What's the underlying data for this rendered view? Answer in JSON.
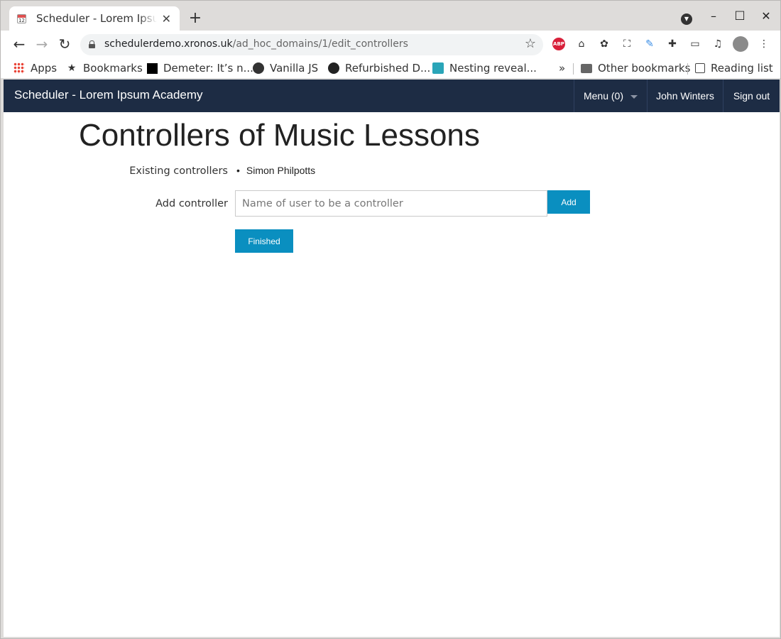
{
  "browser": {
    "tab_title": "Scheduler - Lorem Ipsum Academy",
    "favicon_text": "12",
    "url_host": "schedulerdemo.xronos.uk",
    "url_path": "/ad_hoc_domains/1/edit_controllers",
    "bookmarks": [
      {
        "label": "Apps",
        "icon": "apps-grid-icon"
      },
      {
        "label": "Bookmarks",
        "icon": "star-icon"
      },
      {
        "label": "Demeter: It’s n...",
        "icon": "black-square-icon"
      },
      {
        "label": "Vanilla JS",
        "icon": "globe-icon"
      },
      {
        "label": "Refurbished D...",
        "icon": "circle-logo-icon"
      },
      {
        "label": "Nesting reveal...",
        "icon": "f-logo-icon"
      }
    ],
    "overflow": "»",
    "other_bookmarks": "Other bookmarks",
    "reading_list": "Reading list",
    "abp_text": "ABP"
  },
  "app": {
    "brand": "Scheduler - Lorem Ipsum Academy",
    "menu": "Menu (0)",
    "user": "John Winters",
    "sign_out": "Sign out"
  },
  "main": {
    "title": "Controllers of Music Lessons",
    "existing_label": "Existing controllers",
    "controllers": [
      "Simon Philpotts"
    ],
    "add_label": "Add controller",
    "add_placeholder": "Name of user to be a controller",
    "add_button": "Add",
    "finished_button": "Finished"
  },
  "colors": {
    "navbar_bg": "#1d2c44",
    "button_bg": "#0a8fc0",
    "page_bg": "#ffffff"
  }
}
